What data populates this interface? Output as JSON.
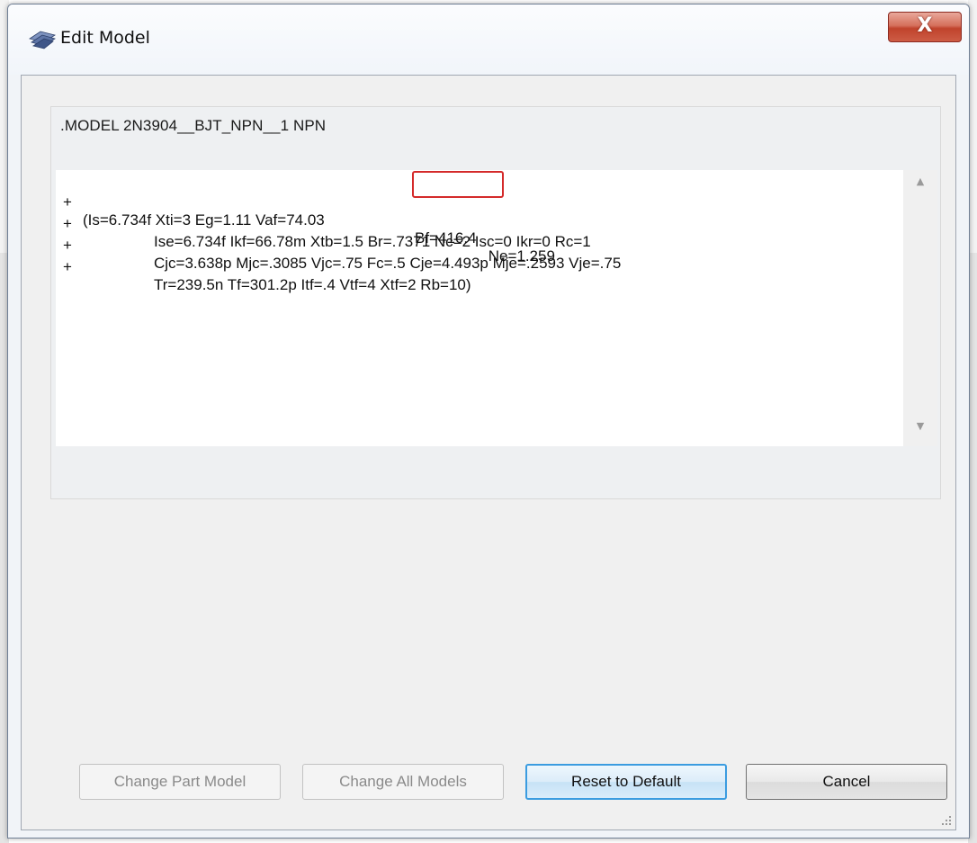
{
  "window": {
    "title": "Edit Model",
    "close_symbol": "X"
  },
  "model": {
    "header": ".MODEL 2N3904__BJT_NPN__1  NPN",
    "lines": [
      {
        "prefix": "+",
        "text_a": "(Is=6.734f Xti=3 Eg=1.11 Vaf=74.03 ",
        "text_highlight": "Bf=416.4",
        "text_b": " Ne=1.259"
      },
      {
        "prefix": "+",
        "text": "Ise=6.734f Ikf=66.78m Xtb=1.5 Br=.7371 Nc=2 Isc=0 Ikr=0 Rc=1"
      },
      {
        "prefix": "+",
        "text": "Cjc=3.638p Mjc=.3085 Vjc=.75 Fc=.5 Cje=4.493p Mje=.2593 Vje=.75"
      },
      {
        "prefix": "+",
        "text": "Tr=239.5n Tf=301.2p Itf=.4 Vtf=4 Xtf=2 Rb=10)"
      }
    ],
    "highlighted_parameter": "Bf=416.4"
  },
  "buttons": {
    "change_part_model": "Change Part Model",
    "change_all_models": "Change All Models",
    "reset_to_default": "Reset to Default",
    "cancel": "Cancel"
  },
  "colors": {
    "highlight_border": "#d42a2a",
    "default_button_border": "#3b9ce0",
    "close_button": "#c0432c"
  }
}
